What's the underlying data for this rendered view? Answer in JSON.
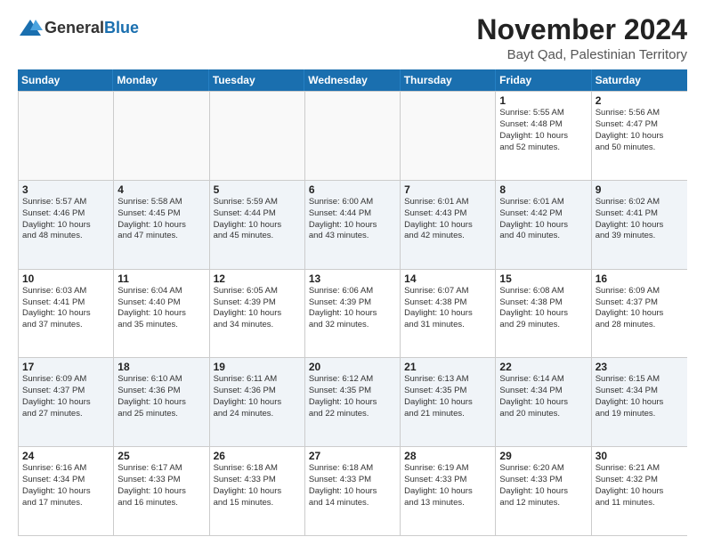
{
  "header": {
    "logo_general": "General",
    "logo_blue": "Blue",
    "month": "November 2024",
    "location": "Bayt Qad, Palestinian Territory"
  },
  "weekdays": [
    "Sunday",
    "Monday",
    "Tuesday",
    "Wednesday",
    "Thursday",
    "Friday",
    "Saturday"
  ],
  "rows": [
    [
      {
        "day": "",
        "info": ""
      },
      {
        "day": "",
        "info": ""
      },
      {
        "day": "",
        "info": ""
      },
      {
        "day": "",
        "info": ""
      },
      {
        "day": "",
        "info": ""
      },
      {
        "day": "1",
        "info": "Sunrise: 5:55 AM\nSunset: 4:48 PM\nDaylight: 10 hours\nand 52 minutes."
      },
      {
        "day": "2",
        "info": "Sunrise: 5:56 AM\nSunset: 4:47 PM\nDaylight: 10 hours\nand 50 minutes."
      }
    ],
    [
      {
        "day": "3",
        "info": "Sunrise: 5:57 AM\nSunset: 4:46 PM\nDaylight: 10 hours\nand 48 minutes."
      },
      {
        "day": "4",
        "info": "Sunrise: 5:58 AM\nSunset: 4:45 PM\nDaylight: 10 hours\nand 47 minutes."
      },
      {
        "day": "5",
        "info": "Sunrise: 5:59 AM\nSunset: 4:44 PM\nDaylight: 10 hours\nand 45 minutes."
      },
      {
        "day": "6",
        "info": "Sunrise: 6:00 AM\nSunset: 4:44 PM\nDaylight: 10 hours\nand 43 minutes."
      },
      {
        "day": "7",
        "info": "Sunrise: 6:01 AM\nSunset: 4:43 PM\nDaylight: 10 hours\nand 42 minutes."
      },
      {
        "day": "8",
        "info": "Sunrise: 6:01 AM\nSunset: 4:42 PM\nDaylight: 10 hours\nand 40 minutes."
      },
      {
        "day": "9",
        "info": "Sunrise: 6:02 AM\nSunset: 4:41 PM\nDaylight: 10 hours\nand 39 minutes."
      }
    ],
    [
      {
        "day": "10",
        "info": "Sunrise: 6:03 AM\nSunset: 4:41 PM\nDaylight: 10 hours\nand 37 minutes."
      },
      {
        "day": "11",
        "info": "Sunrise: 6:04 AM\nSunset: 4:40 PM\nDaylight: 10 hours\nand 35 minutes."
      },
      {
        "day": "12",
        "info": "Sunrise: 6:05 AM\nSunset: 4:39 PM\nDaylight: 10 hours\nand 34 minutes."
      },
      {
        "day": "13",
        "info": "Sunrise: 6:06 AM\nSunset: 4:39 PM\nDaylight: 10 hours\nand 32 minutes."
      },
      {
        "day": "14",
        "info": "Sunrise: 6:07 AM\nSunset: 4:38 PM\nDaylight: 10 hours\nand 31 minutes."
      },
      {
        "day": "15",
        "info": "Sunrise: 6:08 AM\nSunset: 4:38 PM\nDaylight: 10 hours\nand 29 minutes."
      },
      {
        "day": "16",
        "info": "Sunrise: 6:09 AM\nSunset: 4:37 PM\nDaylight: 10 hours\nand 28 minutes."
      }
    ],
    [
      {
        "day": "17",
        "info": "Sunrise: 6:09 AM\nSunset: 4:37 PM\nDaylight: 10 hours\nand 27 minutes."
      },
      {
        "day": "18",
        "info": "Sunrise: 6:10 AM\nSunset: 4:36 PM\nDaylight: 10 hours\nand 25 minutes."
      },
      {
        "day": "19",
        "info": "Sunrise: 6:11 AM\nSunset: 4:36 PM\nDaylight: 10 hours\nand 24 minutes."
      },
      {
        "day": "20",
        "info": "Sunrise: 6:12 AM\nSunset: 4:35 PM\nDaylight: 10 hours\nand 22 minutes."
      },
      {
        "day": "21",
        "info": "Sunrise: 6:13 AM\nSunset: 4:35 PM\nDaylight: 10 hours\nand 21 minutes."
      },
      {
        "day": "22",
        "info": "Sunrise: 6:14 AM\nSunset: 4:34 PM\nDaylight: 10 hours\nand 20 minutes."
      },
      {
        "day": "23",
        "info": "Sunrise: 6:15 AM\nSunset: 4:34 PM\nDaylight: 10 hours\nand 19 minutes."
      }
    ],
    [
      {
        "day": "24",
        "info": "Sunrise: 6:16 AM\nSunset: 4:34 PM\nDaylight: 10 hours\nand 17 minutes."
      },
      {
        "day": "25",
        "info": "Sunrise: 6:17 AM\nSunset: 4:33 PM\nDaylight: 10 hours\nand 16 minutes."
      },
      {
        "day": "26",
        "info": "Sunrise: 6:18 AM\nSunset: 4:33 PM\nDaylight: 10 hours\nand 15 minutes."
      },
      {
        "day": "27",
        "info": "Sunrise: 6:18 AM\nSunset: 4:33 PM\nDaylight: 10 hours\nand 14 minutes."
      },
      {
        "day": "28",
        "info": "Sunrise: 6:19 AM\nSunset: 4:33 PM\nDaylight: 10 hours\nand 13 minutes."
      },
      {
        "day": "29",
        "info": "Sunrise: 6:20 AM\nSunset: 4:33 PM\nDaylight: 10 hours\nand 12 minutes."
      },
      {
        "day": "30",
        "info": "Sunrise: 6:21 AM\nSunset: 4:32 PM\nDaylight: 10 hours\nand 11 minutes."
      }
    ]
  ]
}
